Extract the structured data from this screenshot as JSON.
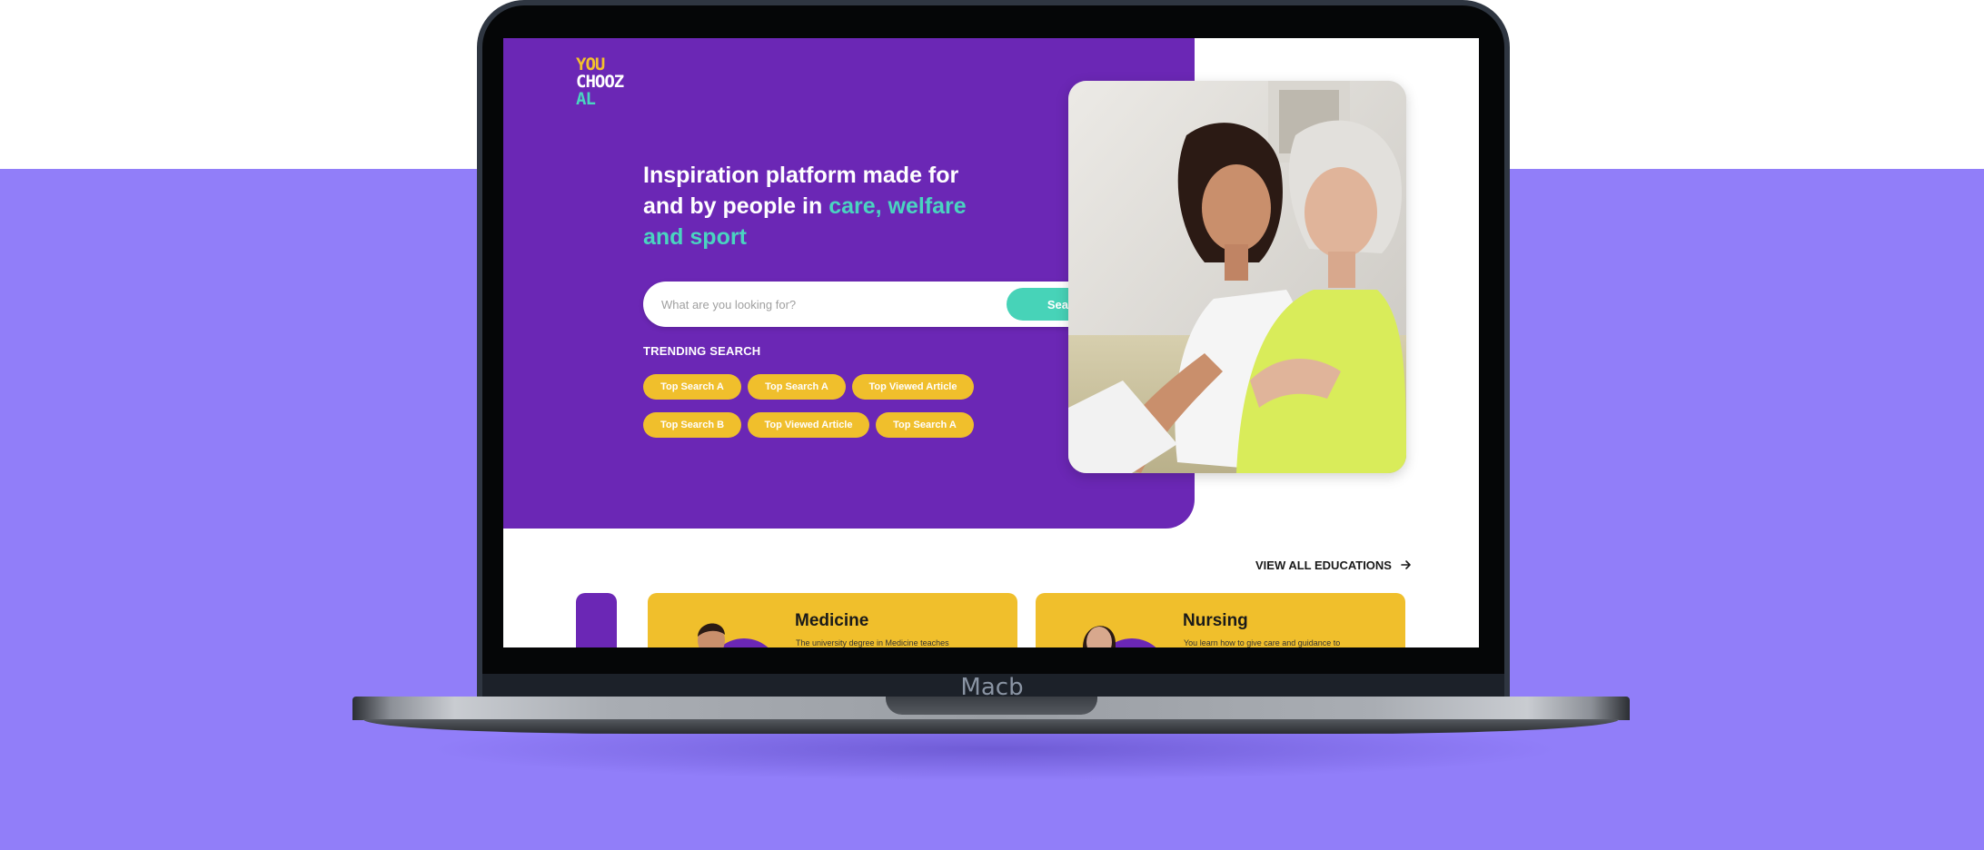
{
  "device": {
    "brand_label": "Macb"
  },
  "logo": {
    "line1": "YOU",
    "line2": "CHOOZ",
    "line3": "AL"
  },
  "hero": {
    "headline_part1": "Inspiration platform made for and by people in ",
    "headline_accent": "care, welfare and sport"
  },
  "search": {
    "placeholder": "What are you looking for?",
    "button_label": "Search"
  },
  "trending": {
    "title": "TRENDING SEARCH",
    "chips": [
      "Top Search A",
      "Top Search A",
      "Top Viewed Article",
      "Top Search B",
      "Top Viewed Article",
      "Top Search A"
    ]
  },
  "educations": {
    "view_all_label": "VIEW ALL EDUCATIONS",
    "cards": [
      {
        "title": "Medicine",
        "description": "The university degree in Medicine teaches"
      },
      {
        "title": "Nursing",
        "description": "You learn how to give care and guidance to"
      }
    ]
  },
  "colors": {
    "page_lower_bg": "#917ef9",
    "hero_purple": "#6b27b5",
    "accent_teal": "#47d3b8",
    "chip_yellow": "#f0bf2c"
  }
}
